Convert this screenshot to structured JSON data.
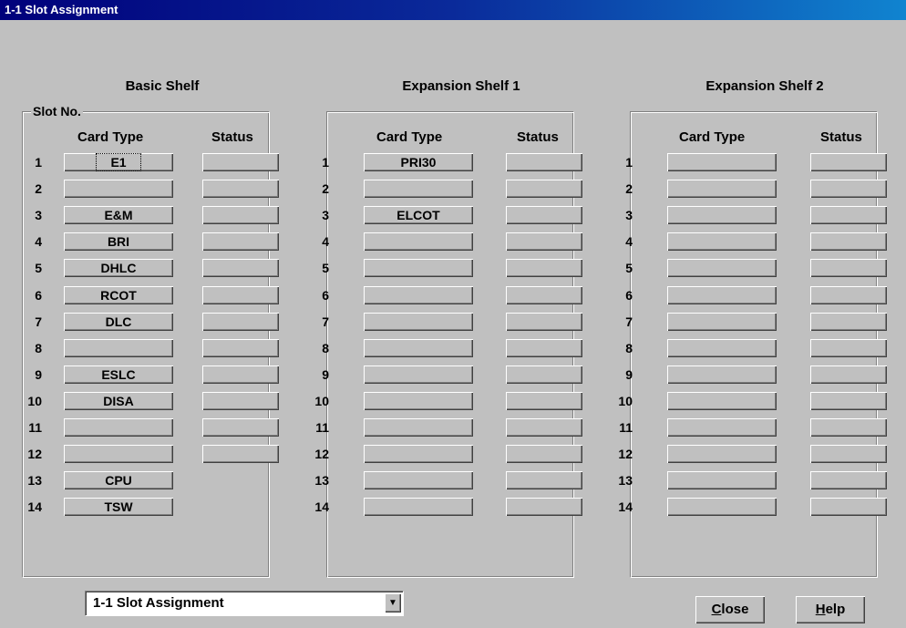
{
  "window": {
    "title": "1-1 Slot Assignment"
  },
  "slot_no_label": "Slot No.",
  "column_headers": {
    "card_type": "Card Type",
    "status": "Status"
  },
  "shelves": [
    {
      "title": "Basic Shelf",
      "slots": [
        {
          "num": "1",
          "card": "E1",
          "status": ""
        },
        {
          "num": "2",
          "card": "",
          "status": ""
        },
        {
          "num": "3",
          "card": "E&M",
          "status": ""
        },
        {
          "num": "4",
          "card": "BRI",
          "status": ""
        },
        {
          "num": "5",
          "card": "DHLC",
          "status": ""
        },
        {
          "num": "6",
          "card": "RCOT",
          "status": ""
        },
        {
          "num": "7",
          "card": "DLC",
          "status": ""
        },
        {
          "num": "8",
          "card": "",
          "status": ""
        },
        {
          "num": "9",
          "card": "ESLC",
          "status": ""
        },
        {
          "num": "10",
          "card": "DISA",
          "status": ""
        },
        {
          "num": "11",
          "card": "",
          "status": ""
        },
        {
          "num": "12",
          "card": "",
          "status": ""
        },
        {
          "num": "13",
          "card": "CPU"
        },
        {
          "num": "14",
          "card": "TSW"
        }
      ]
    },
    {
      "title": "Expansion Shelf 1",
      "slots": [
        {
          "num": "1",
          "card": "PRI30",
          "status": ""
        },
        {
          "num": "2",
          "card": "",
          "status": ""
        },
        {
          "num": "3",
          "card": "ELCOT",
          "status": ""
        },
        {
          "num": "4",
          "card": "",
          "status": ""
        },
        {
          "num": "5",
          "card": "",
          "status": ""
        },
        {
          "num": "6",
          "card": "",
          "status": ""
        },
        {
          "num": "7",
          "card": "",
          "status": ""
        },
        {
          "num": "8",
          "card": "",
          "status": ""
        },
        {
          "num": "9",
          "card": "",
          "status": ""
        },
        {
          "num": "10",
          "card": "",
          "status": ""
        },
        {
          "num": "11",
          "card": "",
          "status": ""
        },
        {
          "num": "12",
          "card": "",
          "status": ""
        },
        {
          "num": "13",
          "card": "",
          "status": ""
        },
        {
          "num": "14",
          "card": "",
          "status": ""
        }
      ]
    },
    {
      "title": "Expansion Shelf 2",
      "slots": [
        {
          "num": "1",
          "card": "",
          "status": ""
        },
        {
          "num": "2",
          "card": "",
          "status": ""
        },
        {
          "num": "3",
          "card": "",
          "status": ""
        },
        {
          "num": "4",
          "card": "",
          "status": ""
        },
        {
          "num": "5",
          "card": "",
          "status": ""
        },
        {
          "num": "6",
          "card": "",
          "status": ""
        },
        {
          "num": "7",
          "card": "",
          "status": ""
        },
        {
          "num": "8",
          "card": "",
          "status": ""
        },
        {
          "num": "9",
          "card": "",
          "status": ""
        },
        {
          "num": "10",
          "card": "",
          "status": ""
        },
        {
          "num": "11",
          "card": "",
          "status": ""
        },
        {
          "num": "12",
          "card": "",
          "status": ""
        },
        {
          "num": "13",
          "card": "",
          "status": ""
        },
        {
          "num": "14",
          "card": "",
          "status": ""
        }
      ]
    }
  ],
  "footer": {
    "menu_select_value": "1-1 Slot Assignment",
    "close_mnemonic": "C",
    "close_rest": "lose",
    "help_mnemonic": "H",
    "help_rest": "elp"
  }
}
